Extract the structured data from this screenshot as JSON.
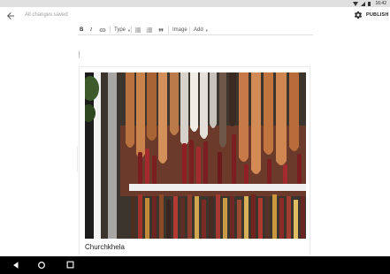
{
  "statusbar": {
    "time": "16:42",
    "icons": [
      "wifi-icon",
      "signal-icon",
      "battery-icon"
    ]
  },
  "appbar": {
    "back_icon": "arrow-left-icon",
    "save_status": "All changes saved",
    "settings_icon": "gear-icon",
    "publish_label": "PUBLISH"
  },
  "toolbar": {
    "bold": "B",
    "italic": "I",
    "link_icon": "link-icon",
    "type_label": "Type",
    "bullet_list_icon": "bulleted-list-icon",
    "numbered_list_icon": "numbered-list-icon",
    "quote_icon": "quote-icon",
    "image_label": "Image",
    "add_label": "Add"
  },
  "card": {
    "caption": "Churchkhela",
    "image_icon": "churchkhela-photo"
  },
  "navbar": {
    "icons": [
      "nav-back-icon",
      "nav-home-icon",
      "nav-recent-icon"
    ]
  },
  "colors": {
    "text": "#222222",
    "muted": "#9e9e9e",
    "navbar": "#000000",
    "statusbar": "#e0e0e0"
  }
}
